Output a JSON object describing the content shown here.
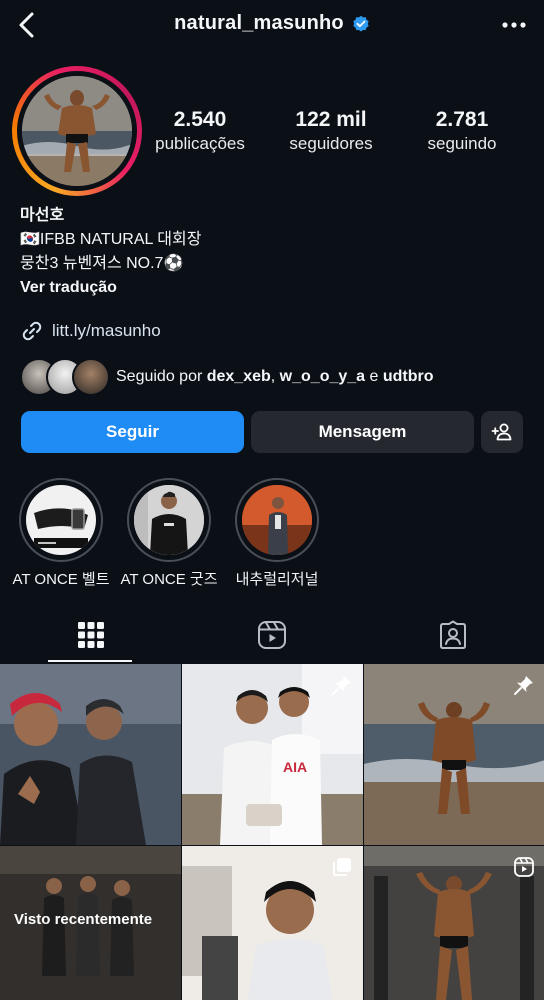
{
  "header": {
    "username": "natural_masunho",
    "back_icon": "chevron-left-icon",
    "verified_icon": "verified-badge-icon",
    "more_icon": "more-horizontal-icon"
  },
  "stats": [
    {
      "value": "2.540",
      "label": "publicações"
    },
    {
      "value": "122 mil",
      "label": "seguidores"
    },
    {
      "value": "2.781",
      "label": "seguindo"
    }
  ],
  "bio": {
    "name": "마선호",
    "line1": "🇰🇷IFBB NATURAL 대회장",
    "line2": "뭉찬3 뉴벤져스 NO.7⚽",
    "translate": "Ver tradução"
  },
  "link": {
    "text": "litt.ly/masunho",
    "icon": "link-icon"
  },
  "followed_by": {
    "prefix": "Seguido por ",
    "user1": "dex_xeb",
    "sep": ", ",
    "user2": "w_o_o_y_a",
    "conj": " e ",
    "user3": "udtbro"
  },
  "buttons": {
    "follow": "Seguir",
    "message": "Mensagem",
    "add_user_icon": "add-person-icon"
  },
  "highlights": [
    {
      "label": "AT ONCE 벨트"
    },
    {
      "label": "AT ONCE 굿즈"
    },
    {
      "label": "내추럴리저널"
    }
  ],
  "tabs": [
    "grid-icon",
    "reels-icon",
    "tagged-icon"
  ],
  "grid": {
    "recently_seen": "Visto recentemente"
  },
  "colors": {
    "background": "#0b0f16",
    "accent": "#1f8cf5",
    "button_secondary": "#25292f",
    "link": "#d8e3f0"
  }
}
